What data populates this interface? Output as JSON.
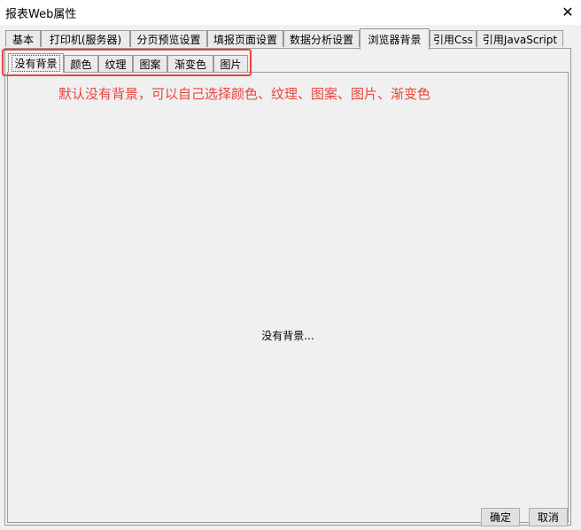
{
  "window": {
    "title": "报表Web属性",
    "close_icon": "close-icon"
  },
  "tabs": [
    {
      "label": "基本"
    },
    {
      "label": "打印机(服务器)"
    },
    {
      "label": "分页预览设置"
    },
    {
      "label": "填报页面设置"
    },
    {
      "label": "数据分析设置"
    },
    {
      "label": "浏览器背景",
      "active": true
    },
    {
      "label": "引用Css"
    },
    {
      "label": "引用JavaScript"
    }
  ],
  "subtabs": [
    {
      "label": "没有背景",
      "active": true
    },
    {
      "label": "颜色"
    },
    {
      "label": "纹理"
    },
    {
      "label": "图案"
    },
    {
      "label": "渐变色"
    },
    {
      "label": "图片"
    }
  ],
  "annotation": {
    "text": "默认没有背景，可以自己选择颜色、纹理、图案、图片、渐变色",
    "color": "#e8453c"
  },
  "panel": {
    "message": "没有背景..."
  },
  "buttons": {
    "ok": "确定",
    "cancel": "取消"
  }
}
